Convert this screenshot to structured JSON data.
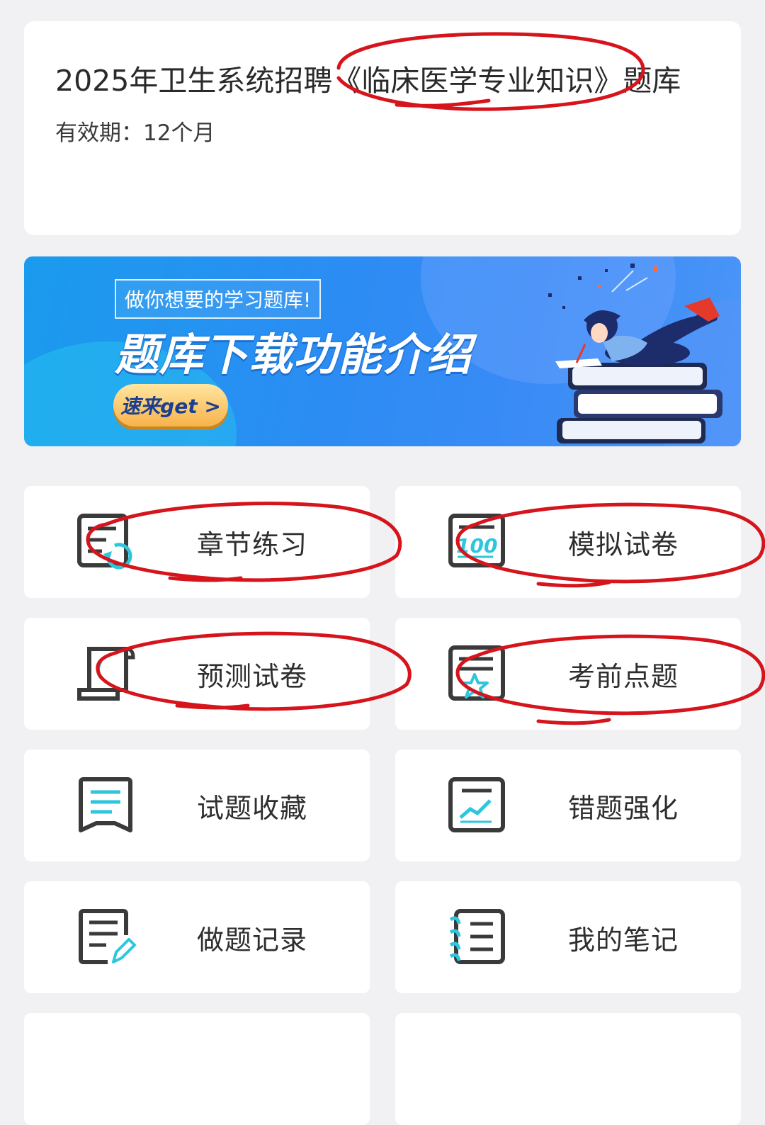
{
  "course": {
    "title": "2025年卫生系统招聘《临床医学专业知识》题库",
    "validity": "有效期：12个月"
  },
  "banner": {
    "tagline": "做你想要的学习题库!",
    "heading": "题库下载功能介绍",
    "cta": "速来get >"
  },
  "menu": [
    {
      "label": "章节练习",
      "icon": "chapter-practice-icon"
    },
    {
      "label": "模拟试卷",
      "icon": "mock-exam-100-icon"
    },
    {
      "label": "预测试卷",
      "icon": "forecast-paper-icon"
    },
    {
      "label": "考前点题",
      "icon": "star-tips-icon"
    },
    {
      "label": "试题收藏",
      "icon": "bookmark-list-icon"
    },
    {
      "label": "错题强化",
      "icon": "trend-chart-icon"
    },
    {
      "label": "做题记录",
      "icon": "edit-record-icon"
    },
    {
      "label": "我的笔记",
      "icon": "notebook-icon"
    }
  ],
  "colors": {
    "accent": "#2ec6dd",
    "icon_stroke": "#3a3a3a",
    "annotation": "#d6141c",
    "banner_blue": "#2c8cf3",
    "cta_gold": "#f8b24a"
  }
}
